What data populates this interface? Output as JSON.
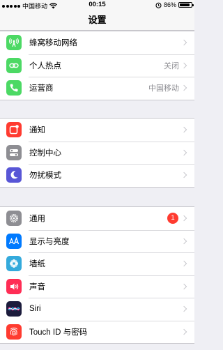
{
  "status_bar": {
    "carrier": "中国移动",
    "time": "00:15",
    "battery": "86%",
    "battery_level": 0.86
  },
  "nav": {
    "title": "设置"
  },
  "groups": [
    {
      "items": [
        {
          "label": "蜂窝移动网络",
          "value": "",
          "icon": "antenna-icon",
          "color": "#4cd964"
        },
        {
          "label": "个人热点",
          "value": "关闭",
          "icon": "hotspot-link-icon",
          "color": "#4cd964"
        },
        {
          "label": "运营商",
          "value": "中国移动",
          "icon": "phone-icon",
          "color": "#4cd964"
        }
      ]
    },
    {
      "items": [
        {
          "label": "通知",
          "value": "",
          "icon": "notifications-icon",
          "color": "#ff3b30"
        },
        {
          "label": "控制中心",
          "value": "",
          "icon": "control-center-icon",
          "color": "#8e8e93"
        },
        {
          "label": "勿扰模式",
          "value": "",
          "icon": "moon-icon",
          "color": "#5856d6"
        }
      ]
    },
    {
      "items": [
        {
          "label": "通用",
          "value": "",
          "badge": "1",
          "icon": "gear-icon",
          "color": "#8e8e93"
        },
        {
          "label": "显示与亮度",
          "value": "",
          "icon": "text-size-icon",
          "color": "#007aff"
        },
        {
          "label": "墙纸",
          "value": "",
          "icon": "flower-icon",
          "color": "#34aadc"
        },
        {
          "label": "声音",
          "value": "",
          "icon": "speaker-icon",
          "color": "#ff2d55"
        },
        {
          "label": "Siri",
          "value": "",
          "icon": "siri-icon",
          "color": "#1c1c3c"
        },
        {
          "label": "Touch ID 与密码",
          "value": "",
          "icon": "fingerprint-icon",
          "color": "#ff3b30"
        }
      ]
    }
  ]
}
